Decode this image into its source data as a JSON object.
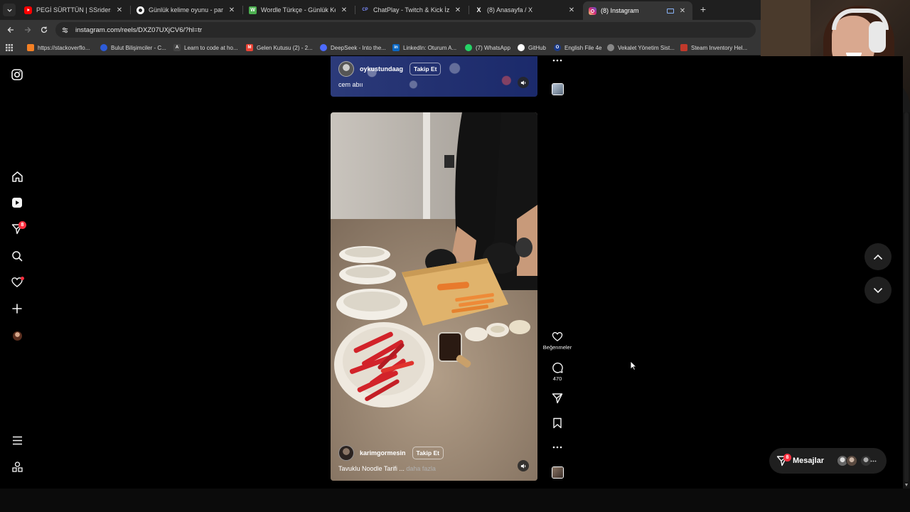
{
  "browser": {
    "tabs": [
      {
        "title": "PEGİ SÜRTTÜN | SSriders | Mot",
        "favicon_color": "#ff0000",
        "active": false
      },
      {
        "title": "Günlük kelime oyunu - parolla",
        "favicon_color": "#ffffff",
        "active": false
      },
      {
        "title": "Wordle Türkçe - Günlük Kelime",
        "favicon_color": "#4caf50",
        "favicon_text": "W",
        "active": false
      },
      {
        "title": "ChatPlay - Twitch & Kick İzleyici",
        "favicon_color": "#5c6bc0",
        "favicon_text": "CP",
        "active": false
      },
      {
        "title": "(8) Anasayfa / X",
        "favicon_color": "#000000",
        "favicon_text": "X",
        "active": false
      },
      {
        "title": "(8) Instagram",
        "favicon_color": "#d62976",
        "active": true
      }
    ],
    "url": "instagram.com/reels/DXZ07UXjCV6/?hl=tr",
    "bookmarks": [
      {
        "label": "https://stackoverflo...",
        "color": "#f48024"
      },
      {
        "label": "Bulut Bilişimciler - C...",
        "color": "#2d5bd8"
      },
      {
        "label": "Learn to code at ho...",
        "color": "#444444",
        "text": "A"
      },
      {
        "label": "Gelen Kutusu (2) - 2...",
        "color": "#ea4335",
        "text": "M"
      },
      {
        "label": "DeepSeek - Into the...",
        "color": "#4d6bfe"
      },
      {
        "label": "LinkedIn: Oturum A...",
        "color": "#0a66c2",
        "text": "in"
      },
      {
        "label": "(7) WhatsApp",
        "color": "#25d366"
      },
      {
        "label": "GitHub",
        "color": "#ffffff"
      },
      {
        "label": "English File 4e",
        "color": "#1a3a8a",
        "text": "O"
      },
      {
        "label": "Vekalet Yönetim Sist...",
        "color": "#888888"
      },
      {
        "label": "Steam Inventory Hel...",
        "color": "#c0392b"
      }
    ]
  },
  "sidebar": {
    "notifications_badge": "8"
  },
  "reels": {
    "previous": {
      "username": "oykustundaag",
      "follow_label": "Takip Et",
      "caption": "cem abıı"
    },
    "current": {
      "username": "karimgormesin",
      "follow_label": "Takip Et",
      "caption": "Tavuklu Noodle Tarifi ...",
      "more_label": "daha fazla"
    }
  },
  "actions": {
    "likes_label": "Beğenmeler",
    "comments_count": "470"
  },
  "messages": {
    "label": "Mesajlar",
    "badge": "8"
  },
  "colors": {
    "badge": "#ff3040",
    "background": "#000000",
    "chrome_toolbar": "#353535"
  }
}
